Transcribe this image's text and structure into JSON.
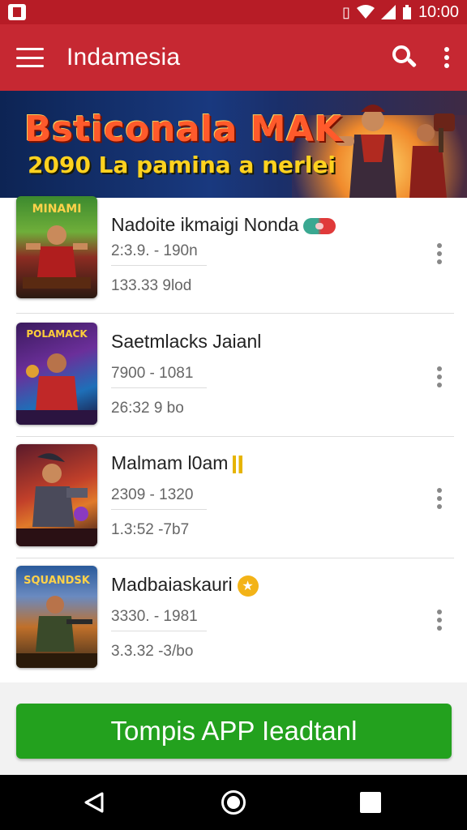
{
  "status_bar": {
    "time": "10:00"
  },
  "app_bar": {
    "title": "Indamesia"
  },
  "banner": {
    "title": "Bsticonala MAK",
    "subtitle": "2090 La pamina a nerlei"
  },
  "list": {
    "items": [
      {
        "title": "Nadoite ikmaigi Nonda",
        "line1": "2:3.9. - 190n",
        "line2": "133.33  9lod",
        "badge": "pill-icon"
      },
      {
        "title": "Saetmlacks Jaianl",
        "line1": "7900  - 1081",
        "line2": "26:32  9 bo",
        "badge": ""
      },
      {
        "title": "Malmam l0am",
        "line1": "2309  - 1320",
        "line2": "1.3:52  -7b7",
        "badge": "gold-bars-icon"
      },
      {
        "title": "Madbaiaskauri",
        "line1": "3330. - 1981",
        "line2": "3.3.32 -3/bo",
        "badge": "star-icon"
      }
    ],
    "thumb_labels": [
      "MINAMI",
      "POLAMACK",
      "",
      "SQUANDSK"
    ]
  },
  "cta": {
    "label": "Tompis APP Ieadtanl"
  },
  "colors": {
    "app_bar": "#c62832",
    "status_bar": "#b71c26",
    "cta": "#23a11e"
  }
}
